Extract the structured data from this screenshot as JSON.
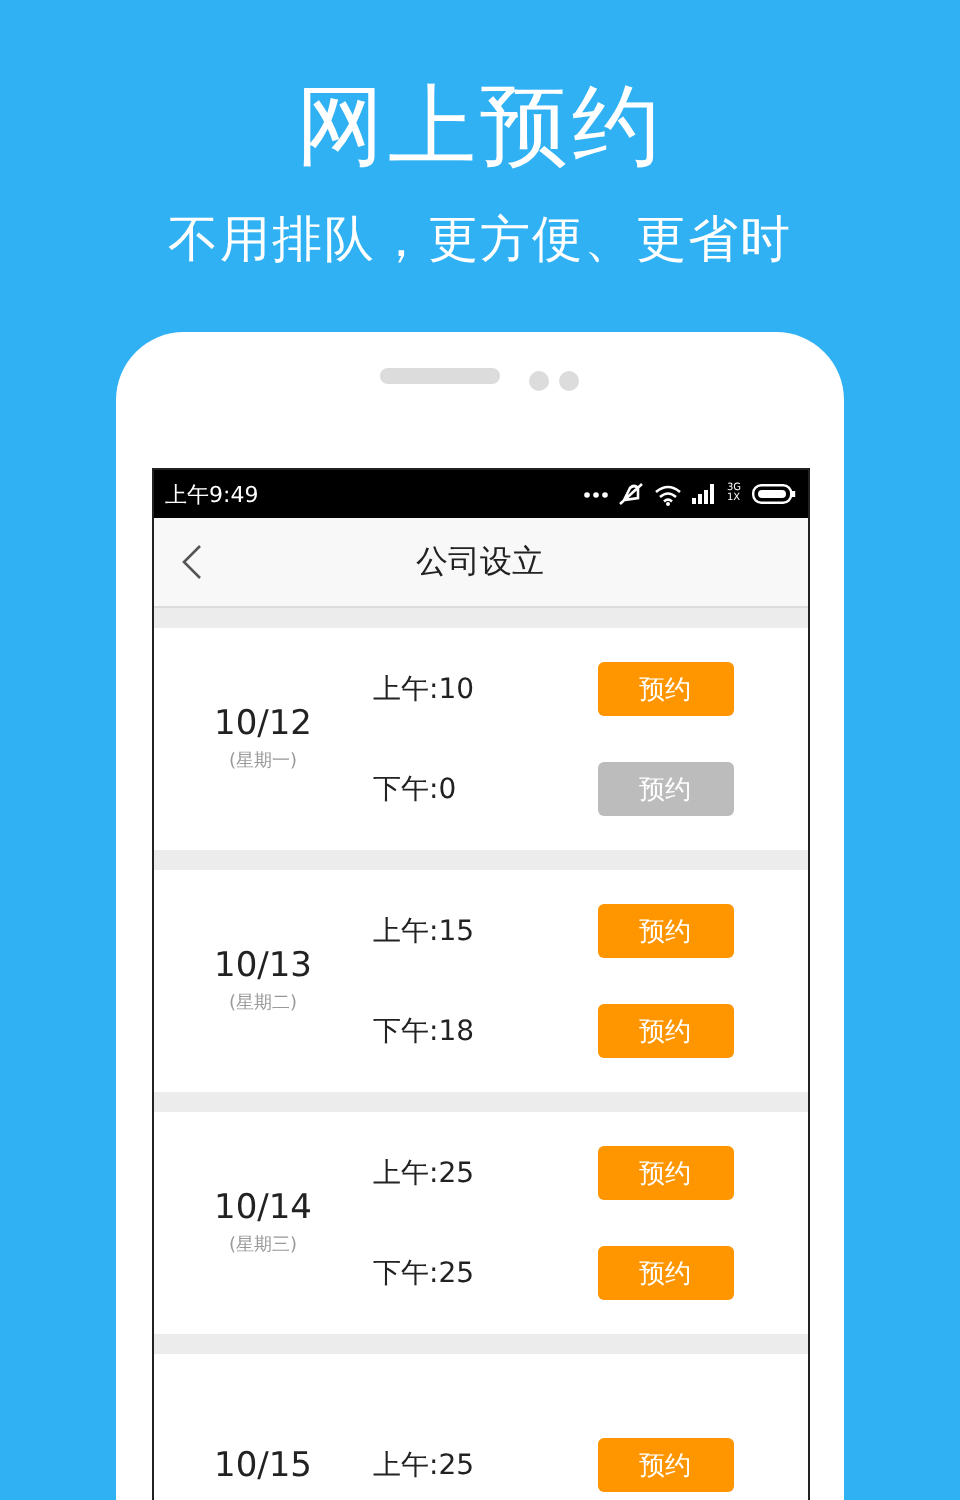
{
  "banner": {
    "title": "网上预约",
    "subtitle": "不用排队，更方便、更省时"
  },
  "status_bar": {
    "time": "上午9:49",
    "network": [
      "3G",
      "1X"
    ]
  },
  "nav": {
    "title": "公司设立"
  },
  "days": [
    {
      "date": "10/12",
      "weekday": "(星期一)",
      "slots": [
        {
          "label": "上午:10",
          "button": "预约",
          "disabled": false
        },
        {
          "label": "下午:0",
          "button": "预约",
          "disabled": true
        }
      ]
    },
    {
      "date": "10/13",
      "weekday": "(星期二)",
      "slots": [
        {
          "label": "上午:15",
          "button": "预约",
          "disabled": false
        },
        {
          "label": "下午:18",
          "button": "预约",
          "disabled": false
        }
      ]
    },
    {
      "date": "10/14",
      "weekday": "(星期三)",
      "slots": [
        {
          "label": "上午:25",
          "button": "预约",
          "disabled": false
        },
        {
          "label": "下午:25",
          "button": "预约",
          "disabled": false
        }
      ]
    },
    {
      "date": "10/15",
      "slots": [
        {
          "label": "上午:25",
          "button": "预约",
          "disabled": false
        }
      ]
    }
  ]
}
